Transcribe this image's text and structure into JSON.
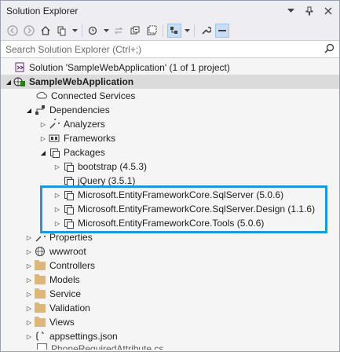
{
  "window": {
    "title": "Solution Explorer",
    "controls": [
      "dropdown-icon",
      "pin-icon",
      "close-icon"
    ]
  },
  "toolbar": {
    "buttons": [
      "back-icon",
      "forward-icon",
      "home-icon",
      "switch-views-icon",
      "pending-changes-icon",
      "sync-icon",
      "collapse-all-icon",
      "show-all-files-icon",
      "preview-selected-icon",
      "properties-icon",
      "dash-icon"
    ]
  },
  "search": {
    "placeholder": "Search Solution Explorer (Ctrl+;)"
  },
  "tree": {
    "solution": "Solution 'SampleWebApplication' (1 of 1 project)",
    "project": "SampleWebApplication",
    "connected_services": "Connected Services",
    "dependencies": "Dependencies",
    "analyzers": "Analyzers",
    "frameworks": "Frameworks",
    "packages": "Packages",
    "package_items": [
      "bootstrap (4.5.3)",
      "jQuery (3.5.1)",
      "Microsoft.EntityFrameworkCore.SqlServer (5.0.6)",
      "Microsoft.EntityFrameworkCore.SqlServer.Design (1.1.6)",
      "Microsoft.EntityFrameworkCore.Tools (5.0.6)"
    ],
    "properties": "Properties",
    "wwwroot": "wwwroot",
    "folders": [
      "Controllers",
      "Models",
      "Service",
      "Validation",
      "Views"
    ],
    "appsettings": "appsettings.json",
    "cut_off_item": "PhoneRequiredAttribute.cs"
  },
  "colors": {
    "highlight": "#1a9ad6",
    "folder": "#dcb67a"
  }
}
